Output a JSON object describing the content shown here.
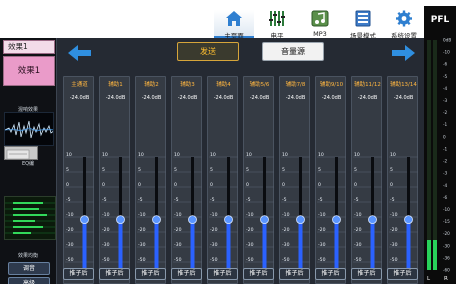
{
  "nav": {
    "items": [
      {
        "label": "主页面",
        "icon": "home-icon",
        "active": true
      },
      {
        "label": "电平",
        "icon": "level-meter-icon",
        "active": false
      },
      {
        "label": "MP3",
        "icon": "mp3-icon",
        "active": false
      },
      {
        "label": "场景模式",
        "icon": "scene-mode-icon",
        "active": false
      },
      {
        "label": "系统设置",
        "icon": "gear-icon",
        "active": false
      }
    ]
  },
  "pfl": {
    "title": "PFL",
    "scale": [
      "0dB",
      "-10",
      "-6",
      "-5",
      "-4",
      "-3",
      "-2",
      "-1",
      "0",
      "-1",
      "-2",
      "-3",
      "-4",
      "-6",
      "-10",
      "-15",
      "-20",
      "-30",
      "-36",
      "-60"
    ],
    "footer": [
      "L",
      "R"
    ]
  },
  "left": {
    "effect_title": "效果1",
    "effect_name": "效果1",
    "reverb_label": "混响效果",
    "delay_label": "EQ编",
    "eq_label": "效果均衡",
    "buttons": [
      "调音",
      "高级"
    ]
  },
  "main": {
    "tabs": {
      "send": "发送",
      "source": "音量源"
    },
    "fader_scale": [
      "10",
      "5",
      "0",
      "-5",
      "-10",
      "-20",
      "-30",
      "-50",
      "-120"
    ],
    "channels": [
      {
        "name": "主通道",
        "db": "-24.0dB",
        "button": "推子后",
        "level": 0.42
      },
      {
        "name": "辅助1",
        "db": "-24.0dB",
        "button": "推子后",
        "level": 0.42
      },
      {
        "name": "辅助2",
        "db": "-24.0dB",
        "button": "推子后",
        "level": 0.42
      },
      {
        "name": "辅助3",
        "db": "-24.0dB",
        "button": "推子后",
        "level": 0.42
      },
      {
        "name": "辅助4",
        "db": "-24.0dB",
        "button": "推子后",
        "level": 0.42
      },
      {
        "name": "辅助5/6",
        "db": "-24.0dB",
        "button": "推子后",
        "level": 0.42
      },
      {
        "name": "辅助7/8",
        "db": "-24.0dB",
        "button": "推子后",
        "level": 0.42
      },
      {
        "name": "辅助9/10",
        "db": "-24.0dB",
        "button": "推子后",
        "level": 0.42
      },
      {
        "name": "辅助11/12",
        "db": "-24.0dB",
        "button": "推子后",
        "level": 0.42
      },
      {
        "name": "辅助13/14",
        "db": "-24.0dB",
        "button": "推子后",
        "level": 0.42
      }
    ]
  },
  "colors": {
    "accent": "#2f7fd0",
    "channel_name": "#ffb640",
    "fader_fill": "#2b62ff",
    "tab_active": "#ffbf30",
    "meter_green": "#28d25a"
  }
}
